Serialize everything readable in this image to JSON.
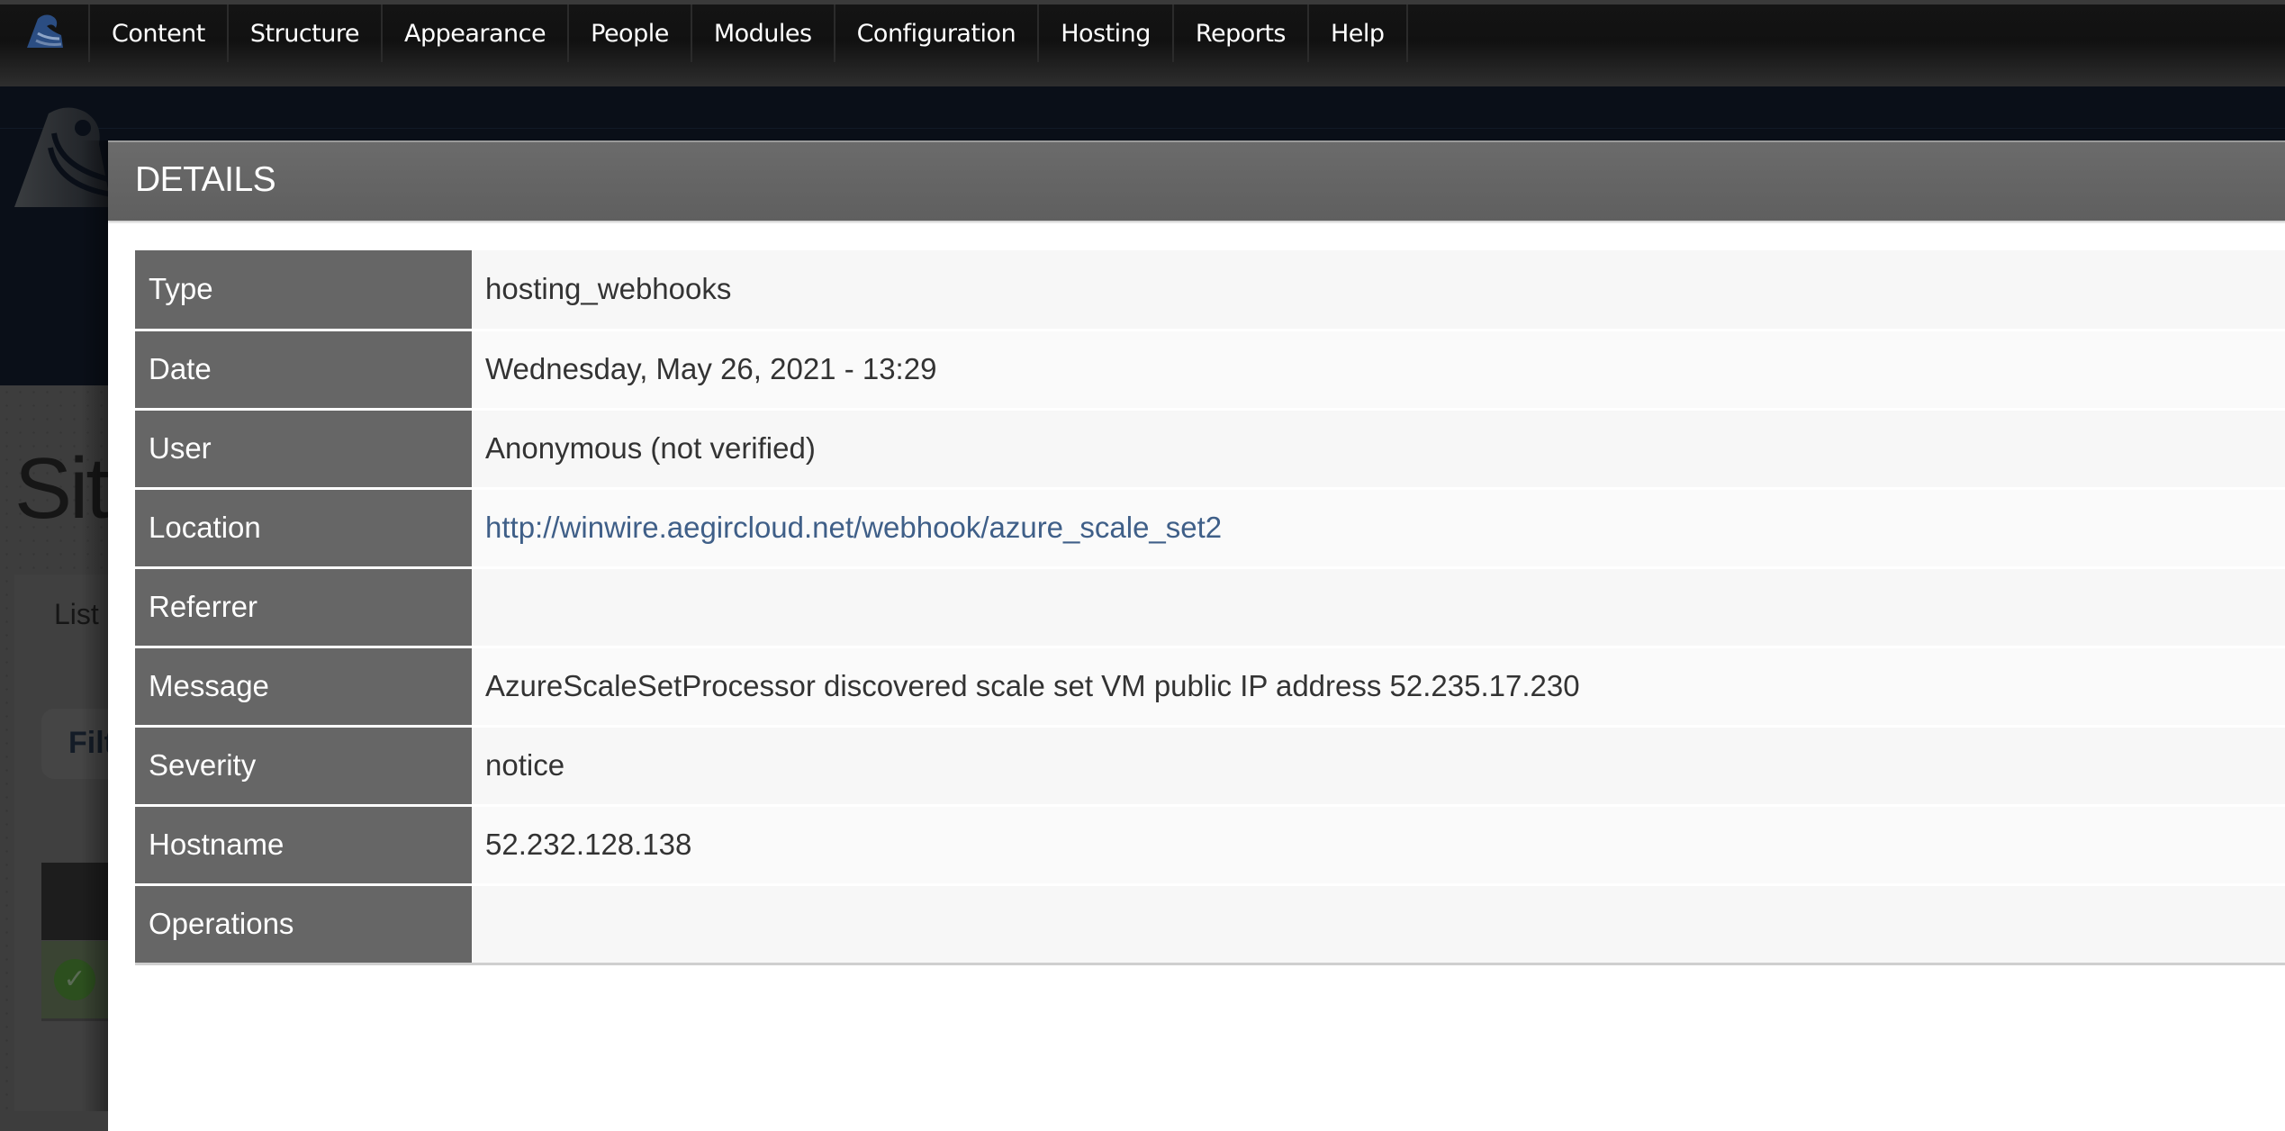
{
  "toolbar": {
    "home_icon": "aegir-logo-icon",
    "items": [
      {
        "label": "Content"
      },
      {
        "label": "Structure"
      },
      {
        "label": "Appearance"
      },
      {
        "label": "People"
      },
      {
        "label": "Modules"
      },
      {
        "label": "Configuration"
      },
      {
        "label": "Hosting"
      },
      {
        "label": "Reports"
      },
      {
        "label": "Help"
      }
    ]
  },
  "background": {
    "page_title": "Sit",
    "tab_label": "List",
    "filter_label": "Filt",
    "status_icon": "check-circle-icon"
  },
  "modal": {
    "title": "DETAILS",
    "rows": [
      {
        "label": "Type",
        "value": "hosting_webhooks"
      },
      {
        "label": "Date",
        "value": "Wednesday, May 26, 2021 - 13:29"
      },
      {
        "label": "User",
        "value": "Anonymous (not verified)"
      },
      {
        "label": "Location",
        "value": "http://winwire.aegircloud.net/webhook/azure_scale_set2"
      },
      {
        "label": "Referrer",
        "value": ""
      },
      {
        "label": "Message",
        "value": "AzureScaleSetProcessor discovered scale set VM public IP address 52.235.17.230"
      },
      {
        "label": "Severity",
        "value": "notice"
      },
      {
        "label": "Hostname",
        "value": "52.232.128.138"
      },
      {
        "label": "Operations",
        "value": ""
      }
    ]
  },
  "colors": {
    "toolbar_bg": "#111111",
    "header_bg": "#0a0f18",
    "modal_header_bg": "#666666",
    "label_cell_bg": "#666666",
    "value_cell_bg": "#f7f7f7",
    "link": "#3f5f88"
  }
}
